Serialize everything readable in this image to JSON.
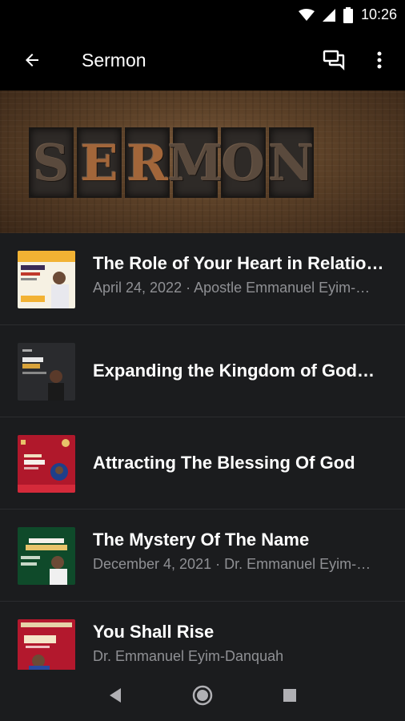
{
  "status_bar": {
    "time": "10:26",
    "icons": [
      "wifi-icon",
      "cell-signal-icon",
      "battery-icon"
    ]
  },
  "toolbar": {
    "title": "Sermon",
    "back_icon": "arrow-back-icon",
    "actions": [
      "chat-icon",
      "more-vert-icon"
    ]
  },
  "hero": {
    "letters": [
      "S",
      "E",
      "R",
      "M",
      "O",
      "N"
    ]
  },
  "sermons": [
    {
      "title": "The Role of Your Heart in Relatio…",
      "subtitle": "April 24, 2022 · Apostle Emmanuel Eyim-…",
      "thumb_colors": [
        "#f6f1e3",
        "#f2b233"
      ]
    },
    {
      "title": "Expanding the Kingdom of God…",
      "subtitle": "",
      "thumb_colors": [
        "#2a2b2e",
        "#3c3d40"
      ]
    },
    {
      "title": "Attracting The Blessing Of God",
      "subtitle": "",
      "thumb_colors": [
        "#b0182b",
        "#d42a3a"
      ]
    },
    {
      "title": "The Mystery Of The Name",
      "subtitle": "December 4, 2021 · Dr. Emmanuel Eyim-…",
      "thumb_colors": [
        "#0f4a2a",
        "#1c6a3a"
      ]
    },
    {
      "title": "You Shall Rise",
      "subtitle": "Dr. Emmanuel Eyim-Danquah",
      "thumb_colors": [
        "#b3182d",
        "#e6d3a8"
      ]
    }
  ],
  "nav_bar": {
    "buttons": [
      "nav-back-icon",
      "nav-home-icon",
      "nav-recents-icon"
    ]
  }
}
